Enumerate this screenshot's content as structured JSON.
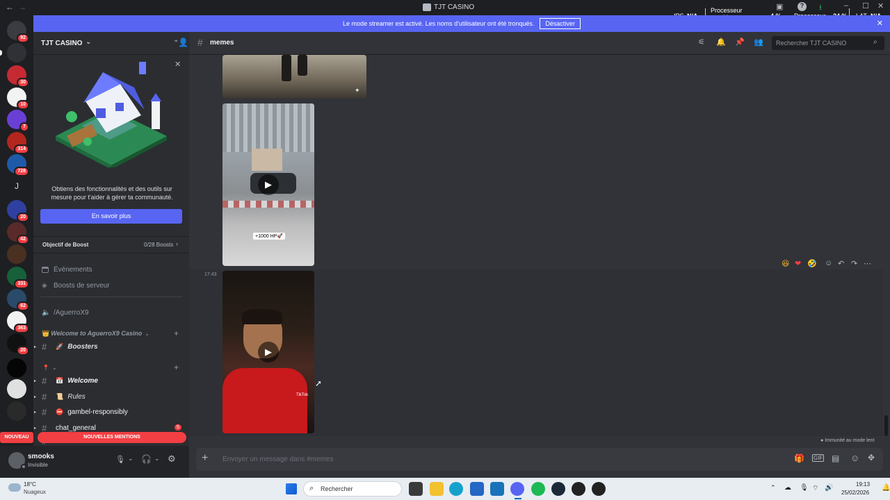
{
  "window": {
    "title": "TJT CASINO"
  },
  "overlay": {
    "ips_label": "IPS",
    "ips_value": "N/A",
    "gpu_label": "Processeur graphique",
    "gpu_value": "4 %",
    "cpu_label": "Processeur",
    "cpu_value": "24 %",
    "lat_label": "LAT",
    "lat_value": "N/A"
  },
  "banner": {
    "text": "Le mode streamer est activé. Les noms d'utilisateur ont été tronqués.",
    "button": "Désactiver"
  },
  "guilds": [
    {
      "badge": "92"
    },
    {
      "badge": ""
    },
    {
      "badge": "30"
    },
    {
      "badge": "10"
    },
    {
      "badge": "7"
    },
    {
      "badge": "314"
    },
    {
      "badge": "728"
    },
    {
      "badge": "",
      "letter": "J"
    },
    {
      "badge": "20"
    },
    {
      "badge": "42"
    },
    {
      "badge": ""
    },
    {
      "badge": "331"
    },
    {
      "badge": "62"
    },
    {
      "badge": "363"
    },
    {
      "badge": "20"
    },
    {
      "badge": ""
    },
    {
      "badge": ""
    },
    {
      "badge": ""
    }
  ],
  "server": {
    "name": "TJT CASINO"
  },
  "promo": {
    "text": "Obtiens des fonctionnalités et des outils sur mesure pour t'aider à gérer ta communauté.",
    "button": "En savoir plus"
  },
  "boost": {
    "label": "Objectif de Boost",
    "value": "0/28 Boosts"
  },
  "menu": [
    {
      "label": "Événements"
    },
    {
      "label": "Boosts de serveur"
    }
  ],
  "voice": {
    "label": "/AguerroX9"
  },
  "categories": {
    "welcome": "Welcome to AguerroX9 Casino"
  },
  "channels": [
    {
      "label": "Boosters",
      "badge": ""
    },
    {
      "label": "Welcome",
      "badge": ""
    },
    {
      "label": "Rules",
      "badge": ""
    },
    {
      "label": "gambel-responsibly",
      "badge": ""
    },
    {
      "label": "chat_general",
      "badge": "5"
    },
    {
      "label": "memes",
      "badge": ""
    }
  ],
  "new_pill": {
    "nouveau": "NOUVEAU",
    "mentions": "NOUVELLES MENTIONS"
  },
  "user": {
    "name": "smooks",
    "status": "Invisible"
  },
  "channel_header": {
    "name": "memes",
    "search_placeholder": "Rechercher TJT CASINO"
  },
  "messages": {
    "video_caption": "+1000 HP🚀",
    "timestamp": "17:43",
    "tiktok": "TikTok"
  },
  "footer": {
    "slowmode": "Immunité au mode lent",
    "composer_placeholder": "Envoyer un message dans #memes"
  },
  "taskbar": {
    "weather_temp": "18°C",
    "weather_desc": "Nuageux",
    "search": "Rechercher",
    "time": "19:13",
    "date": "25/02/2026"
  },
  "colors": {
    "blurple": "#5865f2",
    "red": "#f23f43",
    "bg": "#313338",
    "sidebar": "#2b2d31"
  }
}
